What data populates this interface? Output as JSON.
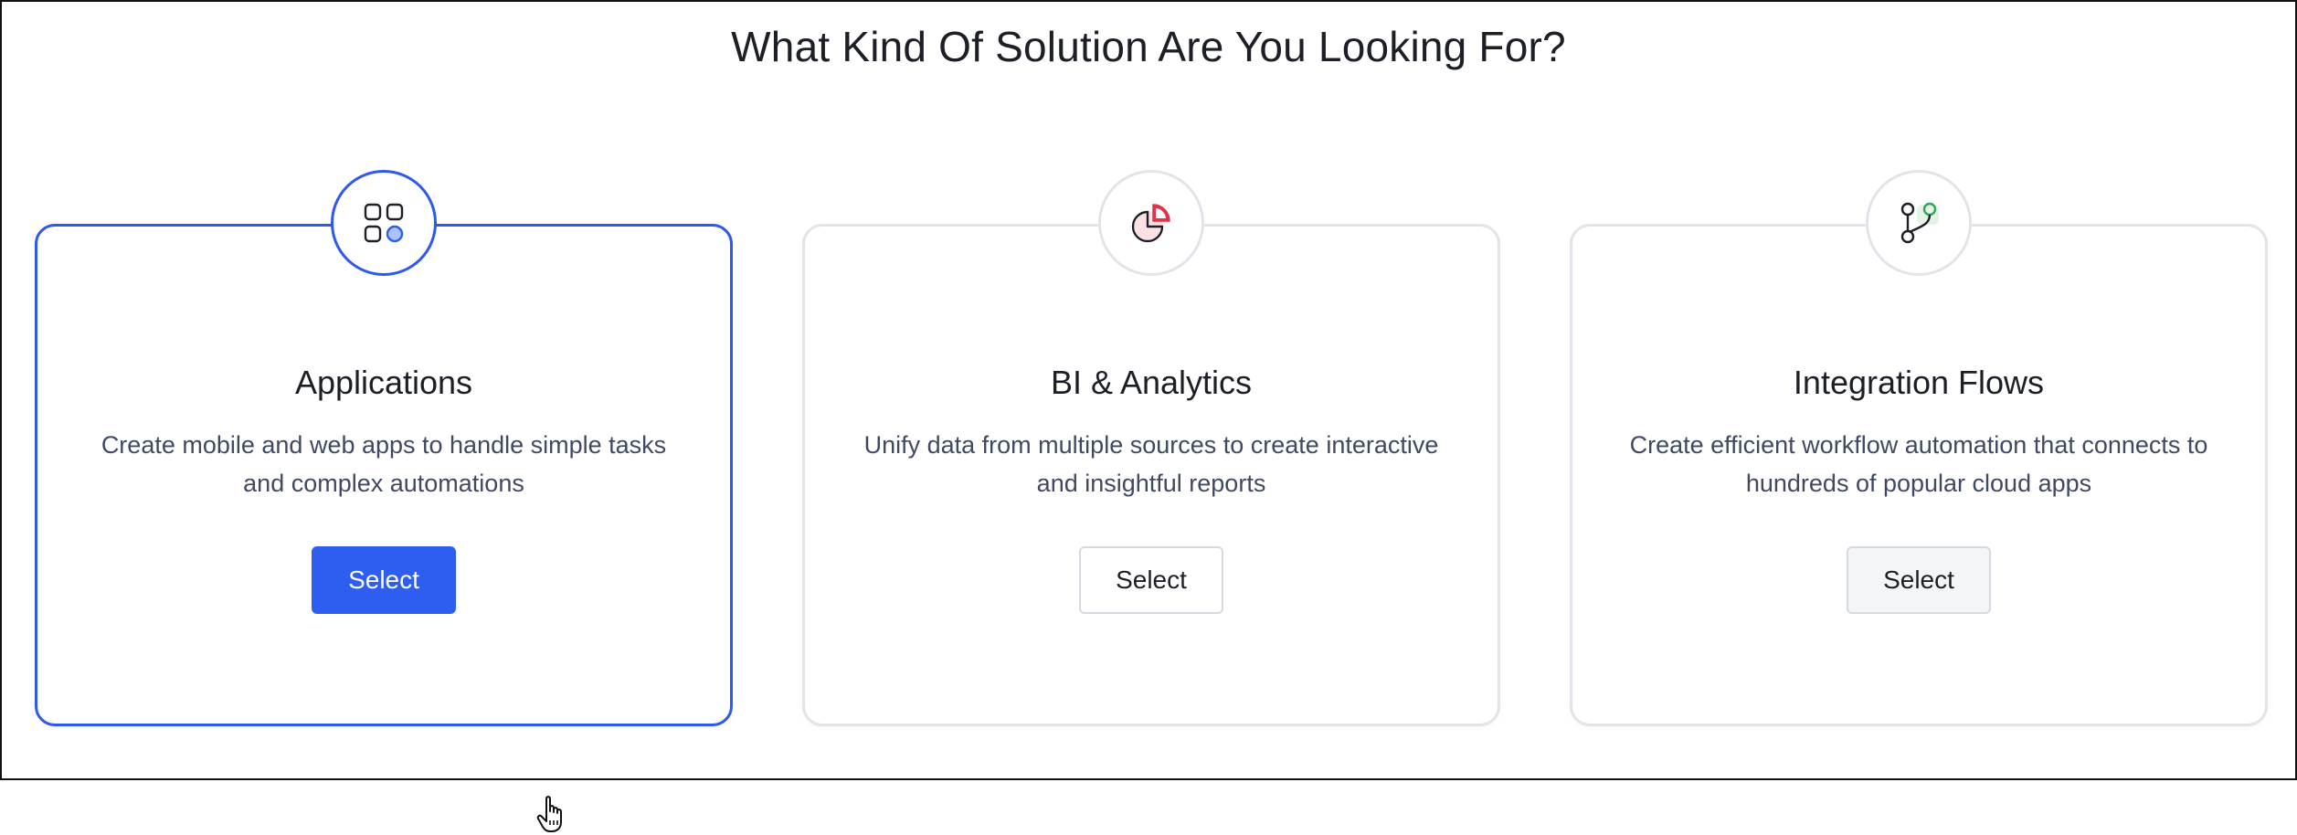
{
  "heading": "What Kind Of Solution Are You Looking For?",
  "colors": {
    "accent": "#2d5ef0",
    "card_border": "#e2e4ea",
    "bi_icon_red": "#e0334a",
    "flow_icon_green": "#35a35a"
  },
  "cards": [
    {
      "title": "Applications",
      "description": "Create mobile and web apps to handle simple tasks and complex automations",
      "button_label": "Select",
      "icon": "apps-grid-icon",
      "state": "selected"
    },
    {
      "title": "BI & Analytics",
      "description": "Unify data from multiple sources to create interactive and insightful reports",
      "button_label": "Select",
      "icon": "pie-chart-icon",
      "state": "default"
    },
    {
      "title": "Integration Flows",
      "description": "Create efficient workflow automation that connects to hundreds of popular cloud apps",
      "button_label": "Select",
      "icon": "flow-branch-icon",
      "state": "hover"
    }
  ]
}
